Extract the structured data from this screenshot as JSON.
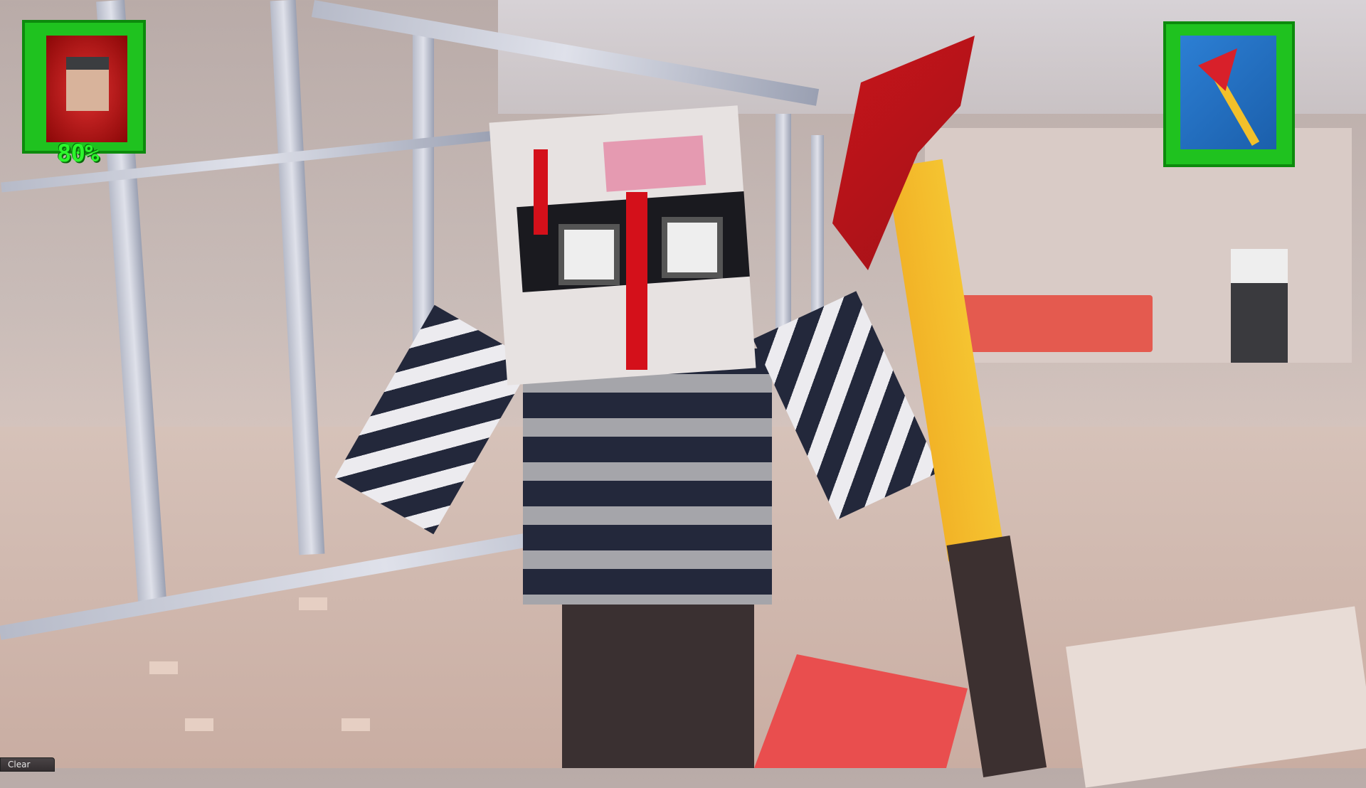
{
  "hud": {
    "portrait_icon": "survivor-portrait-icon",
    "health_label": "80%",
    "health_value": 80,
    "weapon_icon": "fire-axe-icon",
    "frame_color": "#1fc21f",
    "health_text_color": "#2cf52c"
  },
  "console": {
    "clear_label": "Clear"
  }
}
